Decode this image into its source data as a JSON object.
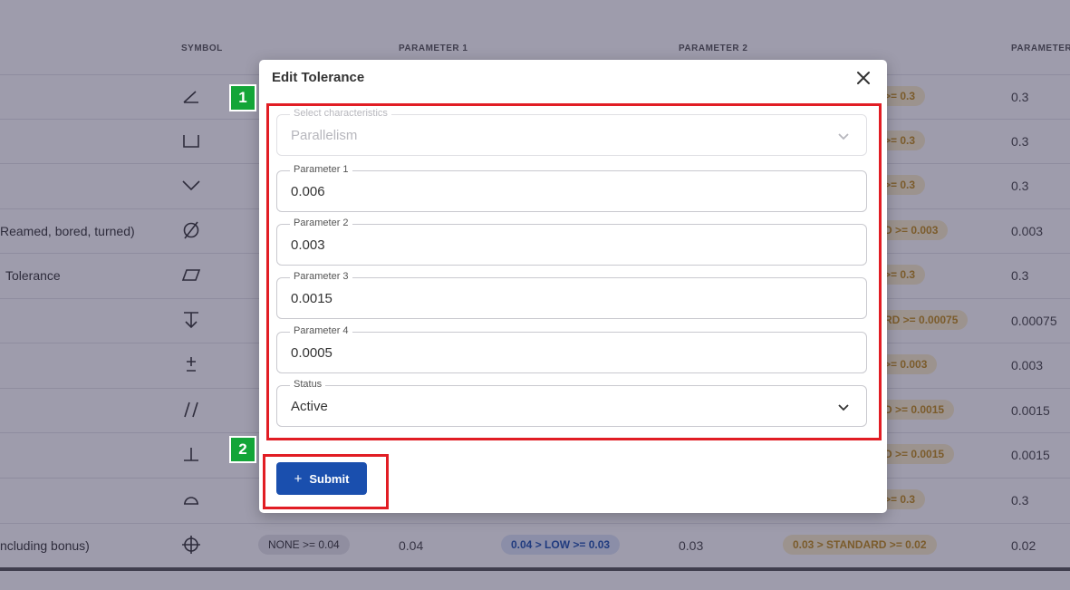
{
  "table": {
    "headers": [
      "SYMBOL",
      "PARAMETER 1",
      "PARAMETER 2",
      "PARAMETER"
    ],
    "rows": [
      {
        "desc": "",
        "symbol": "angle-icon",
        "badge2": ">= 0.3",
        "p4": "0.3"
      },
      {
        "desc": "",
        "symbol": "counterbore-icon",
        "badge2": ">= 0.3",
        "p4": "0.3"
      },
      {
        "desc": "",
        "symbol": "countersink-icon",
        "badge2": ">= 0.3",
        "p4": "0.3"
      },
      {
        "desc": "Reamed, bored, turned)",
        "symbol": "diameter-icon",
        "badge2": "D >= 0.003",
        "p4": "0.003"
      },
      {
        "desc": "Tolerance",
        "symbol": "flatness-icon",
        "badge2": ">= 0.3",
        "p4": "0.3"
      },
      {
        "desc": "",
        "symbol": "depth-icon",
        "badge2": "RD >= 0.00075",
        "p4": "0.00075"
      },
      {
        "desc": "",
        "symbol": "plus-minus-icon",
        "badge2": ">= 0.003",
        "p4": "0.003"
      },
      {
        "desc": "",
        "symbol": "parallelism-icon",
        "badge2": "D >= 0.0015",
        "p4": "0.0015"
      },
      {
        "desc": "",
        "symbol": "perpendicularity-icon",
        "badge2": "D >= 0.0015",
        "p4": "0.0015"
      },
      {
        "desc": "",
        "symbol": "profile-icon",
        "badge2": ">= 0.3",
        "p4": "0.3"
      },
      {
        "desc": "ncluding bonus)",
        "symbol": "position-icon",
        "badge0": "NONE >= 0.04",
        "p1": "0.04",
        "badge1": "0.04 > LOW >= 0.03",
        "p2": "0.03",
        "badge2": "0.03 > STANDARD >= 0.02",
        "p4": "0.02"
      }
    ]
  },
  "modal": {
    "title": "Edit Tolerance",
    "characteristics": {
      "label": "Select characteristics",
      "value": "Parallelism"
    },
    "param1": {
      "label": "Parameter 1",
      "value": "0.006"
    },
    "param2": {
      "label": "Parameter 2",
      "value": "0.003"
    },
    "param3": {
      "label": "Parameter 3",
      "value": "0.0015"
    },
    "param4": {
      "label": "Parameter 4",
      "value": "0.0005"
    },
    "status": {
      "label": "Status",
      "value": "Active"
    },
    "submit_label": "Submit"
  },
  "annotations": {
    "one": "1",
    "two": "2"
  },
  "colors": {
    "primary": "#1a4fae",
    "annotation_red": "#e11d24",
    "annotation_green": "#13a538"
  }
}
